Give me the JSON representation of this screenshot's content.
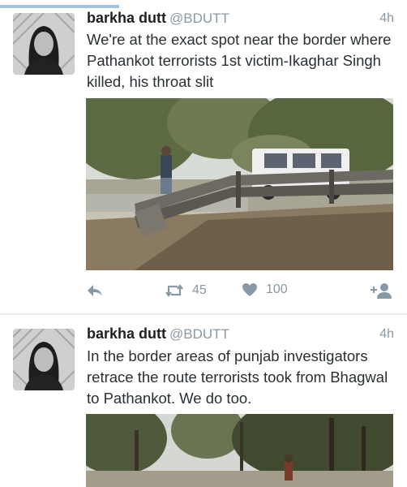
{
  "tweets": [
    {
      "display_name": "barkha dutt",
      "handle": "@BDUTT",
      "time": "4h",
      "text": "We're at the exact spot near the border where Pathankot terrorists 1st victim-Ikaghar Singh killed, his throat slit",
      "actions": {
        "retweets": "45",
        "likes": "100"
      }
    },
    {
      "display_name": "barkha dutt",
      "handle": "@BDUTT",
      "time": "4h",
      "text": "In the border areas of punjab investigators retrace the route terrorists took from Bhagwal to Pathankot. We do too."
    }
  ],
  "icons": {
    "reply": "reply-arrow-icon",
    "retweet": "retweet-icon",
    "like": "heart-icon",
    "follow": "add-user-icon"
  },
  "colors": {
    "accent": "#9fc3e3",
    "meta_text": "#8899a6",
    "body_text": "#292f33",
    "divider": "#e6ecf0"
  }
}
